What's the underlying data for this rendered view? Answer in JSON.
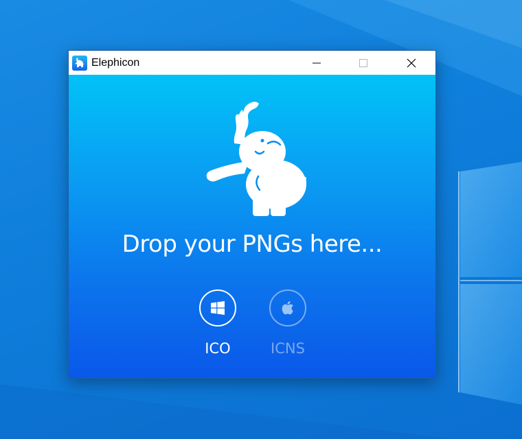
{
  "window": {
    "title": "Elephicon",
    "app_icon": "elephant-icon",
    "controls": {
      "minimize": "minimize-icon",
      "maximize": "maximize-icon",
      "close": "close-icon"
    }
  },
  "main": {
    "logo": "elephant-logo",
    "drop_text": "Drop your PNGs here...",
    "formats": [
      {
        "label": "ICO",
        "icon": "windows-icon",
        "selected": true
      },
      {
        "label": "ICNS",
        "icon": "apple-icon",
        "selected": false
      }
    ]
  },
  "colors": {
    "gradient_top": "#01c2f7",
    "gradient_bottom": "#0a58e9",
    "desktop": "#0f7fdc"
  }
}
